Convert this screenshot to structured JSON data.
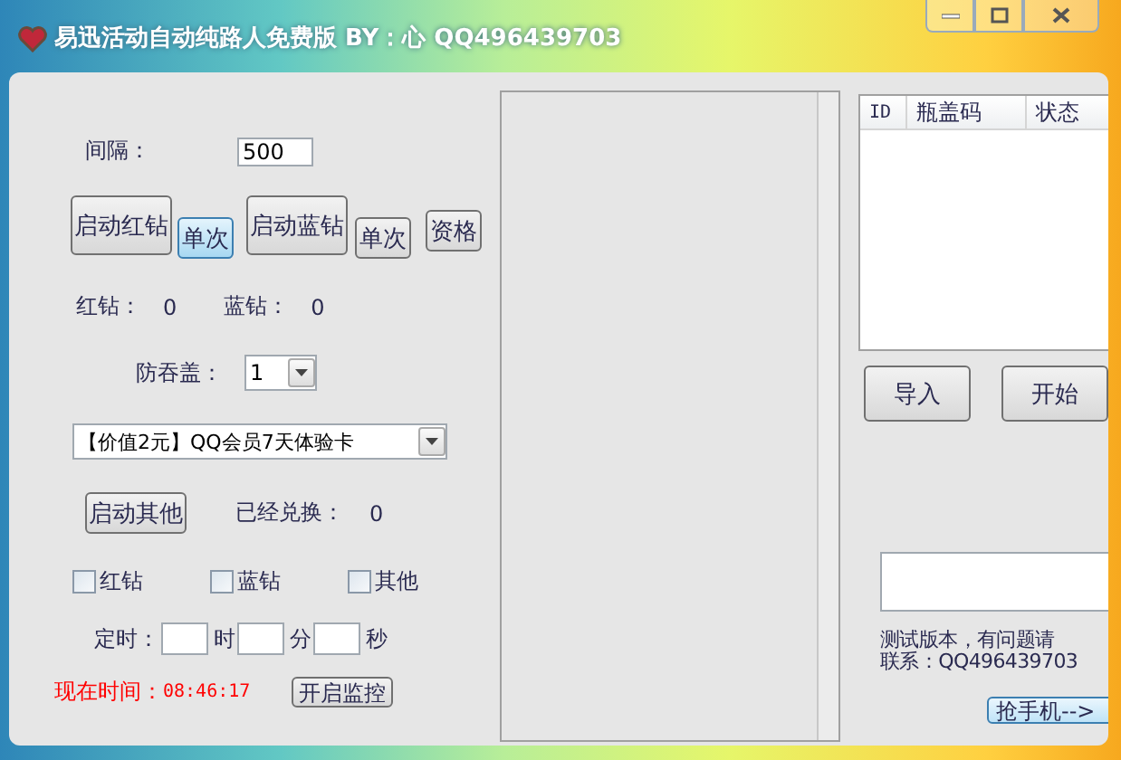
{
  "window": {
    "title": "易迅活动自动纯路人免费版 BY：心 QQ496439703"
  },
  "interval": {
    "label": "间隔：",
    "value": "500"
  },
  "action_buttons": [
    {
      "label": "启动红钻",
      "kind": "large",
      "focused": false
    },
    {
      "label": "单次",
      "kind": "small",
      "focused": true
    },
    {
      "label": "启动蓝钻",
      "kind": "large",
      "focused": false
    },
    {
      "label": "单次",
      "kind": "small",
      "focused": false
    },
    {
      "label": "资格",
      "kind": "small",
      "focused": false
    }
  ],
  "counters": [
    {
      "label": "红钻：",
      "value": "0"
    },
    {
      "label": "蓝钻：",
      "value": "0"
    }
  ],
  "anti_swallow": {
    "label": "防吞盖：",
    "value": "1"
  },
  "prize_select": {
    "value": "【价值2元】QQ会员7天体验卡"
  },
  "other": {
    "button": "启动其他",
    "label": "已经兑换：",
    "value": "0"
  },
  "checkboxes": [
    {
      "label": "红钻",
      "checked": false
    },
    {
      "label": "蓝钻",
      "checked": false
    },
    {
      "label": "其他",
      "checked": false
    }
  ],
  "timer": {
    "label": "定时：",
    "units": [
      "时",
      "分",
      "秒"
    ]
  },
  "clock": {
    "label": "现在时间：",
    "value": "08:46:17",
    "button": "开启监控"
  },
  "code_table": {
    "columns": [
      "ID",
      "瓶盖码",
      "状态"
    ]
  },
  "table_buttons": [
    "导入",
    "开始"
  ],
  "notice": [
    "测试版本，有问题请",
    "联系：QQ496439703"
  ],
  "phone_button": "抢手机-->"
}
